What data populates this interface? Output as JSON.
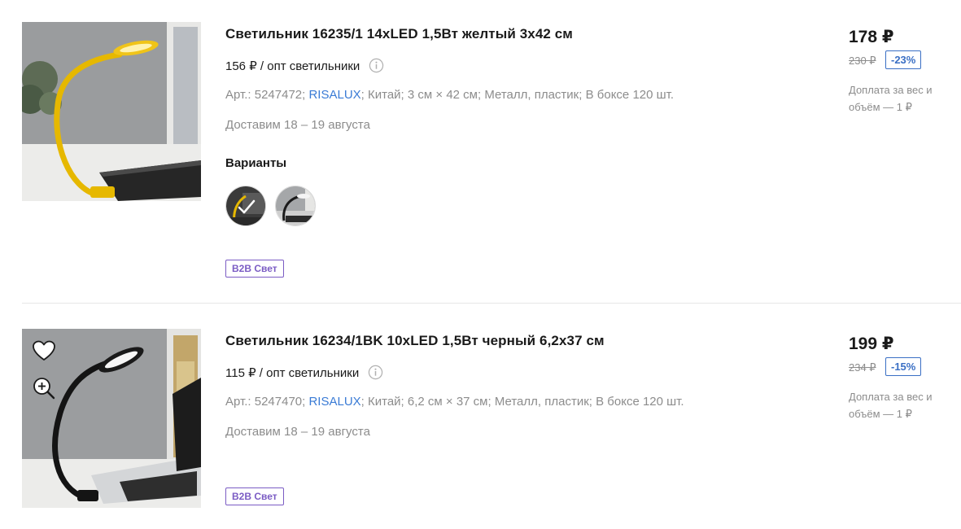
{
  "products": [
    {
      "title": "Светильник 16235/1 14xLED 1,5Вт желтый 3х42 см",
      "wholesale": "156 ₽ / опт светильники",
      "specs": {
        "article": "Арт.: 5247472;",
        "brand": "RISALUX",
        "country": "Китай;",
        "size": "3 см × 42 см;",
        "material": "Металл, пластик;",
        "box": "В боксе 120 шт."
      },
      "delivery": "Доставим 18 – 19 августа",
      "variants_label": "Варианты",
      "badge": "B2B Свет",
      "price": "178 ₽",
      "old_price": "230 ₽",
      "discount": "-23%",
      "surcharge": "Доплата за вес и объём — 1 ₽",
      "icons": [
        "info-icon",
        "check-icon"
      ]
    },
    {
      "title": "Светильник 16234/1BK 10xLED 1,5Вт черный 6,2х37 см",
      "wholesale": "115 ₽ / опт светильники",
      "specs": {
        "article": "Арт.: 5247470;",
        "brand": "RISALUX",
        "country": "Китай;",
        "size": "6,2 см × 37 см;",
        "material": "Металл, пластик;",
        "box": "В боксе 120 шт."
      },
      "delivery": "Доставим 18 – 19 августа",
      "badge": "B2B Свет",
      "price": "199 ₽",
      "old_price": "234 ₽",
      "discount": "-15%",
      "surcharge": "Доплата за вес и объём — 1 ₽",
      "icons": [
        "heart-icon",
        "zoom-in-icon",
        "info-icon"
      ]
    }
  ],
  "colors": {
    "link": "#3a7bd5",
    "badge": "#7b5cc4",
    "discount": "#3a6fc4",
    "muted": "#8c8c8c"
  }
}
